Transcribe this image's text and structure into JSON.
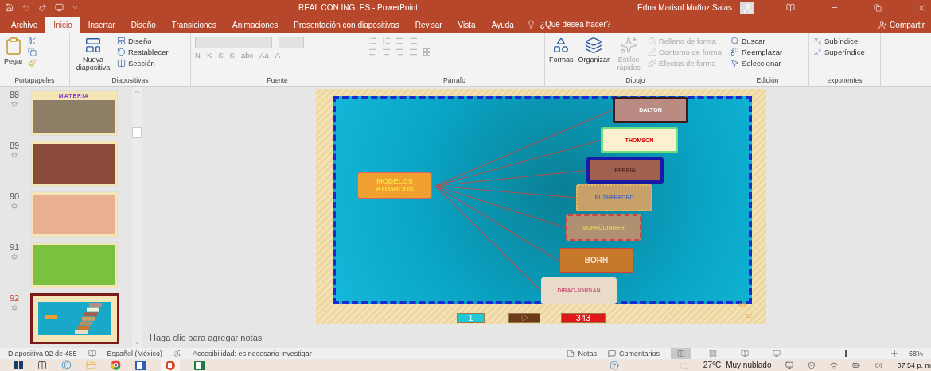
{
  "title_bar": {
    "title": "REAL CON INGLES  -  PowerPoint",
    "user": "Edna Marisol Muñoz Salas"
  },
  "tabs": [
    {
      "label": "Archivo",
      "selected": false
    },
    {
      "label": "Inicio",
      "selected": true
    },
    {
      "label": "Insertar",
      "selected": false
    },
    {
      "label": "Diseño",
      "selected": false
    },
    {
      "label": "Transiciones",
      "selected": false
    },
    {
      "label": "Animaciones",
      "selected": false
    },
    {
      "label": "Presentación con diapositivas",
      "selected": false
    },
    {
      "label": "Revisar",
      "selected": false
    },
    {
      "label": "Vista",
      "selected": false
    },
    {
      "label": "Ayuda",
      "selected": false
    }
  ],
  "tell_me": "¿Qué desea hacer?",
  "share": "Compartir",
  "ribbon_groups": [
    {
      "label": "Portapapeles",
      "large": [
        {
          "label": "Pegar",
          "disabled": false
        }
      ]
    },
    {
      "label": "Diapositivas",
      "large": [
        {
          "label": "Nueva diapositiva",
          "disabled": false
        }
      ],
      "small": [
        {
          "label": "Diseño",
          "disabled": false
        },
        {
          "label": "Restablecer",
          "disabled": false
        },
        {
          "label": "Sección",
          "disabled": false
        }
      ]
    },
    {
      "label": "Fuente",
      "format": [
        "N",
        "K",
        "S",
        "S",
        "abc",
        "Aa",
        "A"
      ]
    },
    {
      "label": "Párrafo"
    },
    {
      "label": "Dibujo",
      "large": [
        {
          "label": "Formas",
          "disabled": false
        },
        {
          "label": "Organizar",
          "disabled": false
        },
        {
          "label": "Estilos rápidos",
          "disabled": true
        }
      ],
      "small": [
        {
          "label": "Relleno de forma",
          "disabled": true
        },
        {
          "label": "Contorno de forma",
          "disabled": true
        },
        {
          "label": "Efectos de forma",
          "disabled": true
        }
      ]
    },
    {
      "label": "Edición",
      "small": [
        {
          "label": "Buscar",
          "disabled": false
        },
        {
          "label": "Reemplazar",
          "disabled": false
        },
        {
          "label": "Seleccionar",
          "disabled": false
        }
      ]
    },
    {
      "label": "exponentes",
      "small": [
        {
          "label": "Subíndice",
          "disabled": false
        },
        {
          "label": "Superíndice",
          "disabled": false
        }
      ]
    }
  ],
  "thumbnails": [
    {
      "number": "88",
      "title": "MATERIA",
      "color": "#8e7e66",
      "selected": false
    },
    {
      "number": "89",
      "color": "#8a4a3a",
      "selected": false
    },
    {
      "number": "90",
      "color": "#e8b090",
      "selected": false
    },
    {
      "number": "91",
      "color": "#7cc040",
      "selected": false
    },
    {
      "number": "92",
      "color": "#1aa8c8",
      "selected": true
    }
  ],
  "slide": {
    "center": {
      "label": "MODELOS ATÓMICOS"
    },
    "models": [
      {
        "label": "DALTON",
        "color": "#b98b82"
      },
      {
        "label": "THOMSON",
        "color": "#fdf0d0"
      },
      {
        "label": "PERRIN",
        "color": "#a0614f"
      },
      {
        "label": "RUTHERFORD",
        "color": "#c8a06a"
      },
      {
        "label": "SCHRÖDINGER",
        "color": "#b09070"
      },
      {
        "label": "BORH",
        "color": "#c8782a"
      },
      {
        "label": "DIRAC-JORDAN",
        "color": "#e8dcc8"
      }
    ],
    "nav": {
      "first": "1",
      "last": "343"
    },
    "page_number": "92"
  },
  "notes_placeholder": "Haga clic para agregar notas",
  "status_bar": {
    "slide": "Diapositiva 92 de 485",
    "language": "Español (México)",
    "accessibility": "Accesibilidad: es necesario investigar",
    "notes": "Notas",
    "comments": "Comentarios",
    "zoom": "68%",
    "zoom_slider": {
      "level": 0.45
    }
  },
  "taskbar": {
    "temperature": "27°C",
    "weather": "Muy nublado",
    "time": "07:54 p. m"
  }
}
